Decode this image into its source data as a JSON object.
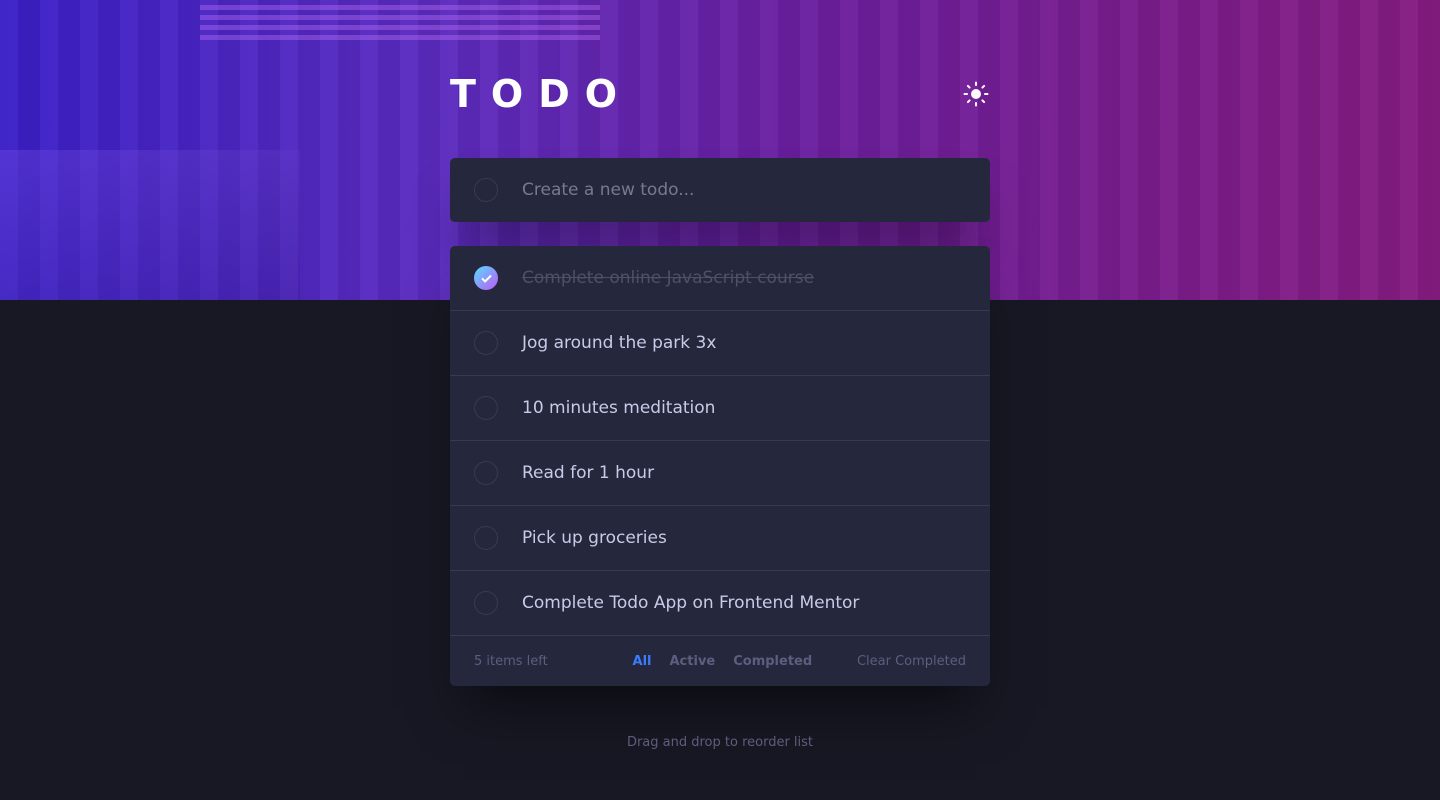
{
  "header": {
    "title": "TODO",
    "theme_toggle_icon": "sun-icon"
  },
  "new_todo": {
    "placeholder": "Create a new todo...",
    "value": ""
  },
  "todos": [
    {
      "text": "Complete online JavaScript course",
      "completed": true
    },
    {
      "text": "Jog around the park 3x",
      "completed": false
    },
    {
      "text": "10 minutes meditation",
      "completed": false
    },
    {
      "text": "Read for 1 hour",
      "completed": false
    },
    {
      "text": "Pick up groceries",
      "completed": false
    },
    {
      "text": "Complete Todo App on Frontend Mentor",
      "completed": false
    }
  ],
  "footer": {
    "items_left": "5 items left",
    "filters": [
      {
        "label": "All",
        "active": true
      },
      {
        "label": "Active",
        "active": false
      },
      {
        "label": "Completed",
        "active": false
      }
    ],
    "clear_label": "Clear Completed"
  },
  "hint": "Drag and drop to reorder list",
  "colors": {
    "accent": "#3a7cfd",
    "check_gradient_start": "#55ddff",
    "check_gradient_end": "#c058f3",
    "card": "#25273d",
    "background": "#171823"
  }
}
